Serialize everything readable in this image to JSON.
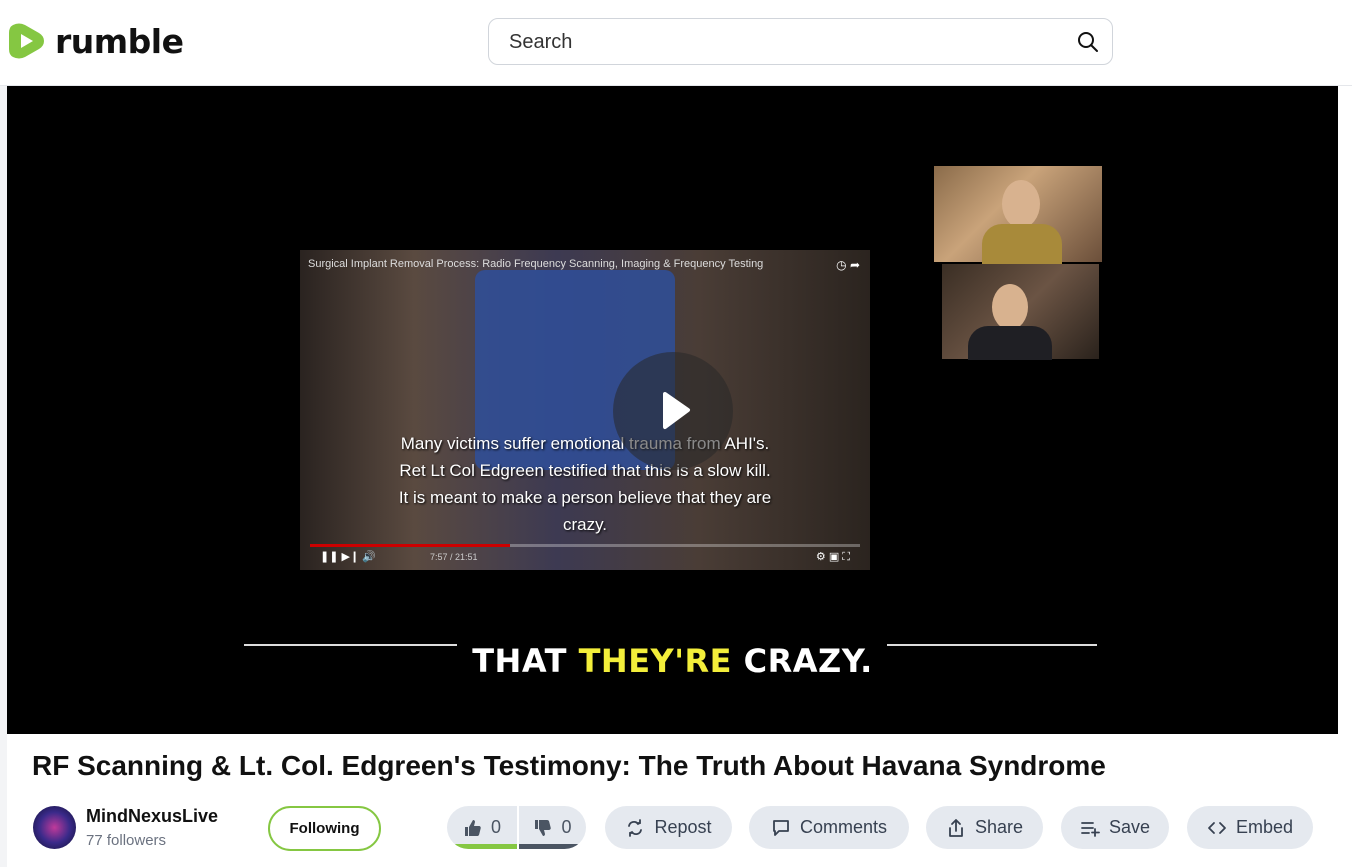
{
  "brand": {
    "name": "rumble",
    "accent": "#85c742"
  },
  "search": {
    "placeholder": "Search"
  },
  "video": {
    "inner_title": "Surgical Implant Removal Process: Radio Frequency Scanning, Imaging & Frequency Testing",
    "inner_subtitle": "Many victims suffer emotional trauma from AHI's.  Ret Lt Col Edgreen testified that this is a slow kill.  It is meant to make a person believe that they are crazy.",
    "inner_time": "7:57 / 21:51",
    "caption_pre": "THAT ",
    "caption_highlight": "THEY'RE",
    "caption_post": " CRAZY."
  },
  "title": "RF Scanning & Lt. Col. Edgreen's Testimony: The Truth About Havana Syndrome",
  "channel": {
    "name": "MindNexusLive",
    "followers": "77 followers",
    "follow_label": "Following"
  },
  "votes": {
    "up": "0",
    "down": "0"
  },
  "actions": {
    "repost": "Repost",
    "comments": "Comments",
    "share": "Share",
    "save": "Save",
    "embed": "Embed"
  }
}
